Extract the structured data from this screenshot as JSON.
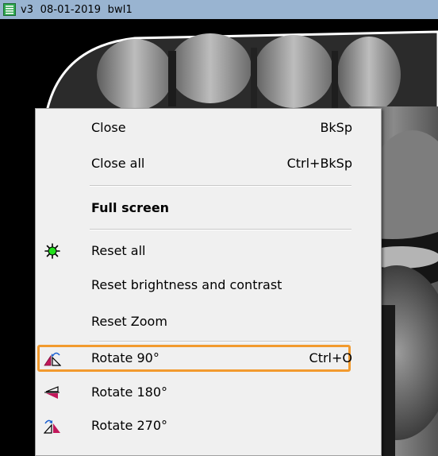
{
  "window": {
    "title": "v3  08-01-2019  bwl1",
    "titlebar_color": "#99b4d1"
  },
  "icons": {
    "app": "list-window-icon",
    "reset_all": "green-sun-icon",
    "rotate_90": "rotate-90-icon",
    "rotate_180": "rotate-180-icon",
    "rotate_270": "rotate-270-icon"
  },
  "menu": {
    "items": [
      {
        "label": "Close",
        "shortcut": "BkSp"
      },
      {
        "label": "Close all",
        "shortcut": "Ctrl+BkSp"
      },
      {
        "label": "Full screen",
        "shortcut": ""
      },
      {
        "label": "Reset all",
        "shortcut": ""
      },
      {
        "label": "Reset brightness and contrast",
        "shortcut": ""
      },
      {
        "label": "Reset Zoom",
        "shortcut": ""
      },
      {
        "label": "Rotate 90°",
        "shortcut": "Ctrl+O"
      },
      {
        "label": "Rotate 180°",
        "shortcut": ""
      },
      {
        "label": "Rotate 270°",
        "shortcut": ""
      }
    ],
    "highlighted_item": "Rotate 90°",
    "highlight_color": "#f29a2e"
  }
}
